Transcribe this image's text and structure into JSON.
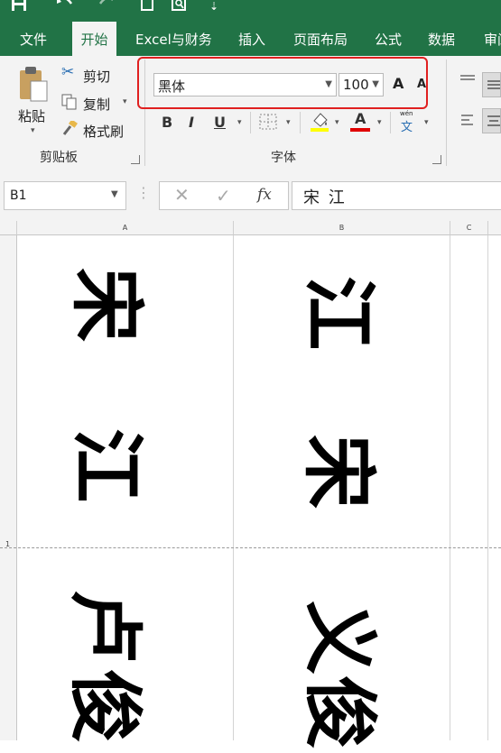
{
  "quick_access": {
    "save_icon": "save-icon",
    "undo_icon": "undo-icon",
    "redo_icon": "redo-icon",
    "new_icon": "new-icon",
    "preview_icon": "print-preview-icon",
    "customize": "⇣"
  },
  "tabs": [
    {
      "label": "文件"
    },
    {
      "label": "开始"
    },
    {
      "label": "Excel与财务"
    },
    {
      "label": "插入"
    },
    {
      "label": "页面布局"
    },
    {
      "label": "公式"
    },
    {
      "label": "数据"
    },
    {
      "label": "审阅"
    }
  ],
  "ribbon": {
    "clipboard": {
      "paste": "粘贴",
      "cut": "剪切",
      "copy": "复制",
      "format_painter": "格式刷",
      "group_label": "剪贴板"
    },
    "font": {
      "name": "黑体",
      "size": "100",
      "bold": "B",
      "italic": "I",
      "underline": "U",
      "font_color_letter": "A",
      "grow": "A",
      "shrink": "A",
      "wen_top": "wén",
      "wen_bottom": "文",
      "group_label": "字体"
    }
  },
  "formula_bar": {
    "name_box": "B1",
    "fx": "fx",
    "content": "宋 江"
  },
  "columns": [
    {
      "label": "A"
    },
    {
      "label": "B"
    },
    {
      "label": "C"
    }
  ],
  "row_number": "1",
  "cells": {
    "A": [
      "宋",
      "江",
      "卢",
      "俊"
    ],
    "B": [
      "江",
      "宋",
      "义",
      "俊"
    ]
  },
  "colors": {
    "excel_green": "#217346",
    "highlight_red": "#e02020",
    "fill_yellow": "#ffff00",
    "font_red": "#e00000"
  }
}
